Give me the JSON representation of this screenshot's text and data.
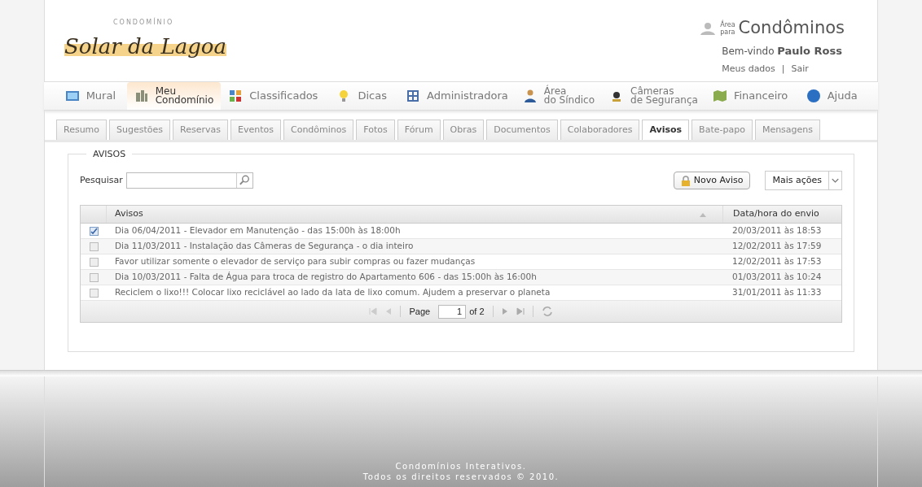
{
  "logo": {
    "small": "CONDOMÍNIO",
    "name": "Solar da Lagoa"
  },
  "user_area": {
    "prefix_top": "Área",
    "prefix_bottom": "para",
    "title": "Condôminos",
    "welcome": "Bem-vindo",
    "user": "Paulo Ross",
    "links": [
      "Meus dados",
      "Sair"
    ],
    "separator": "|"
  },
  "main_nav": [
    {
      "lines": [
        "Mural"
      ],
      "selected": false
    },
    {
      "lines": [
        "Meu",
        "Condomínio"
      ],
      "selected": true
    },
    {
      "lines": [
        "Classificados"
      ],
      "selected": false
    },
    {
      "lines": [
        "Dicas"
      ],
      "selected": false
    },
    {
      "lines": [
        "Administradora"
      ],
      "selected": false
    },
    {
      "lines": [
        "Área",
        "do Síndico"
      ],
      "selected": false
    },
    {
      "lines": [
        "Câmeras",
        "de Segurança"
      ],
      "selected": false
    },
    {
      "lines": [
        "Financeiro"
      ],
      "selected": false
    },
    {
      "lines": [
        "Ajuda"
      ],
      "selected": false
    }
  ],
  "sub_tabs": [
    {
      "label": "Resumo",
      "selected": false
    },
    {
      "label": "Sugestões",
      "selected": false
    },
    {
      "label": "Reservas",
      "selected": false
    },
    {
      "label": "Eventos",
      "selected": false
    },
    {
      "label": "Condôminos",
      "selected": false
    },
    {
      "label": "Fotos",
      "selected": false
    },
    {
      "label": "Fórum",
      "selected": false
    },
    {
      "label": "Obras",
      "selected": false
    },
    {
      "label": "Documentos",
      "selected": false
    },
    {
      "label": "Colaboradores",
      "selected": false
    },
    {
      "label": "Avisos",
      "selected": true
    },
    {
      "label": "Bate-papo",
      "selected": false
    },
    {
      "label": "Mensagens",
      "selected": false
    }
  ],
  "panel": {
    "title": "AVISOS",
    "search_label": "Pesquisar",
    "new_button": "Novo Aviso",
    "more_actions": "Mais ações",
    "table": {
      "columns": [
        "Avisos",
        "Data/hora do envio"
      ],
      "rows": [
        {
          "checked": true,
          "text": "Dia 06/04/2011 - Elevador em Manutenção - das 15:00h às 18:00h",
          "date": "20/03/2011 às 18:53"
        },
        {
          "checked": false,
          "text": "Dia 11/03/2011 - Instalação das Câmeras de Segurança - o dia inteiro",
          "date": "12/02/2011 às 17:59"
        },
        {
          "checked": false,
          "text": "Favor utilizar somente o elevador de serviço para subir compras ou fazer mudanças",
          "date": "12/02/2011 às 17:53"
        },
        {
          "checked": false,
          "text": "Dia 10/03/2011 - Falta de Água para troca de registro do Apartamento 606 - das 15:00h às 16:00h",
          "date": "01/03/2011 às 10:24"
        },
        {
          "checked": false,
          "text": "Reciclem o lixo!!! Colocar lixo reciclável ao lado da lata de lixo comum. Ajudem a preservar o planeta",
          "date": "31/01/2011 às 11:33"
        }
      ]
    },
    "pager": {
      "page_label": "Page",
      "page": "1",
      "of": "of 2"
    }
  },
  "footer": [
    "Condomínios Interativos.",
    "Todos os direitos reservados © 2010."
  ]
}
